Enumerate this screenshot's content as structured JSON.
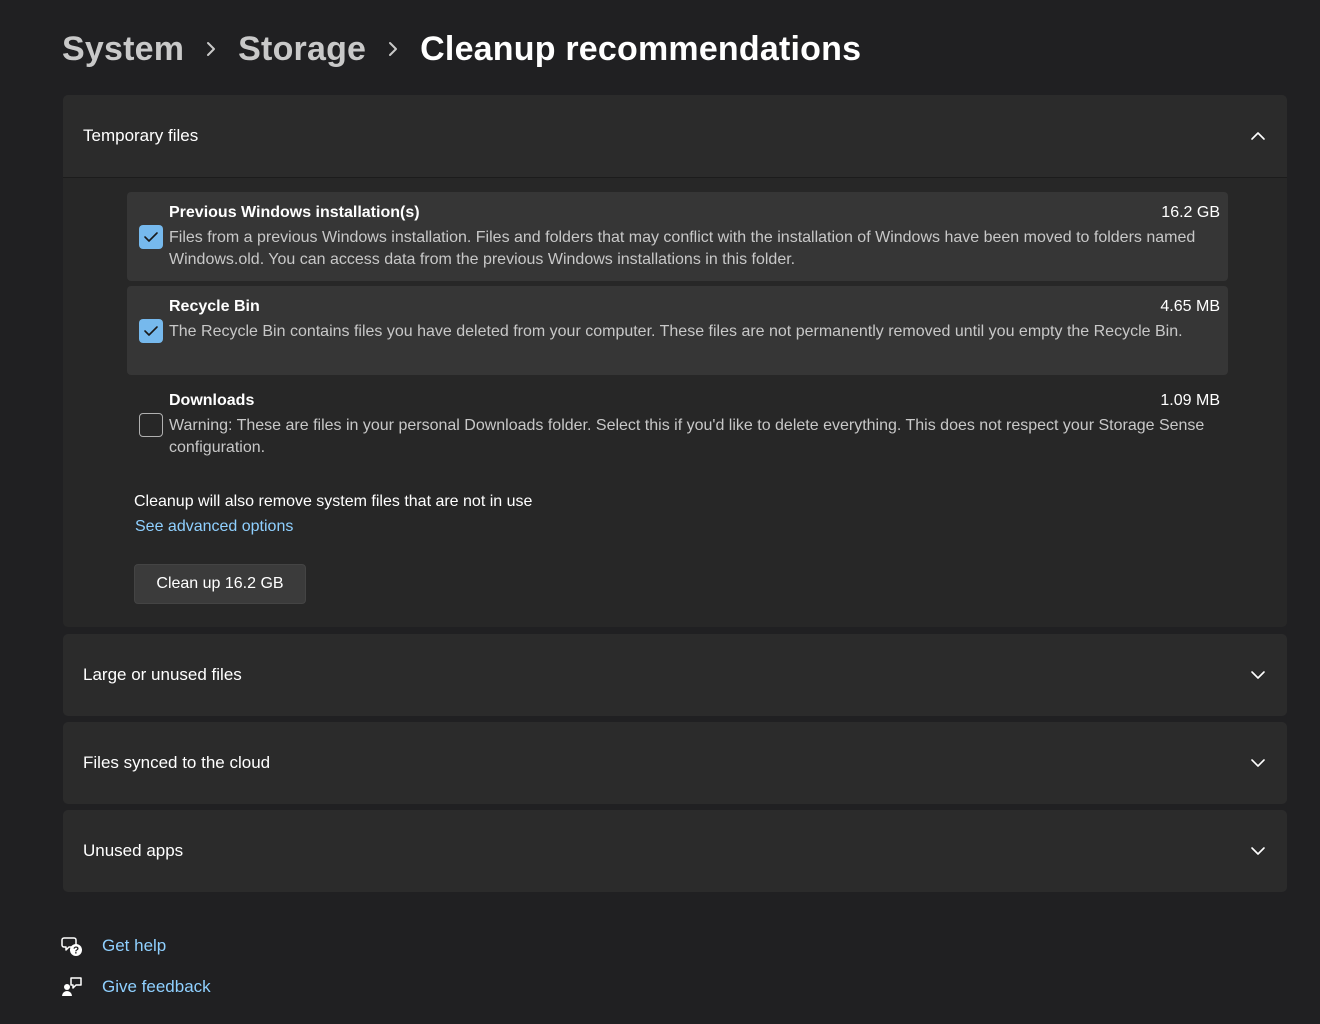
{
  "breadcrumb": {
    "items": [
      "System",
      "Storage"
    ],
    "current": "Cleanup recommendations"
  },
  "sections": {
    "temporary_files": {
      "title": "Temporary files",
      "expanded": true,
      "items": [
        {
          "title": "Previous Windows installation(s)",
          "size": "16.2 GB",
          "description": "Files from a previous Windows installation.  Files and folders that may conflict with the installation of Windows have been moved to folders named Windows.old.  You can access data from the previous Windows installations in this folder.",
          "checked": true
        },
        {
          "title": "Recycle Bin",
          "size": "4.65 MB",
          "description": "The Recycle Bin contains files you have deleted from your computer. These files are not permanently removed until you empty the Recycle Bin.",
          "checked": true
        },
        {
          "title": "Downloads",
          "size": "1.09 MB",
          "description": "Warning: These are files in your personal Downloads folder. Select this if you'd like to delete everything. This does not respect your Storage Sense configuration.",
          "checked": false
        }
      ],
      "note": "Cleanup will also remove system files that are not in use",
      "advanced_link": "See advanced options",
      "cleanup_button": "Clean up 16.2 GB"
    },
    "large_files": {
      "title": "Large or unused files",
      "expanded": false
    },
    "cloud_files": {
      "title": "Files synced to the cloud",
      "expanded": false
    },
    "unused_apps": {
      "title": "Unused apps",
      "expanded": false
    }
  },
  "footer": {
    "help": "Get help",
    "feedback": "Give feedback"
  },
  "colors": {
    "background": "#202022",
    "card": "#2b2b2b",
    "accent": "#76b9ed",
    "link": "#8fd0ff"
  }
}
